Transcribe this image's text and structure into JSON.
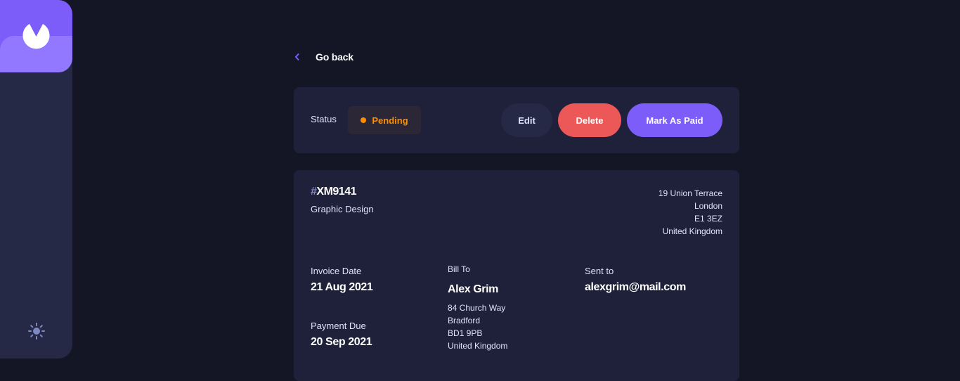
{
  "nav": {
    "back_label": "Go back"
  },
  "status_bar": {
    "status_label": "Status",
    "status_value": "Pending",
    "edit_label": "Edit",
    "delete_label": "Delete",
    "mark_paid_label": "Mark As Paid"
  },
  "invoice": {
    "hash": "#",
    "id": "XM9141",
    "description": "Graphic Design",
    "sender_address": [
      "19 Union Terrace",
      "London",
      "E1 3EZ",
      "United Kingdom"
    ],
    "invoice_date_label": "Invoice Date",
    "invoice_date": "21 Aug 2021",
    "payment_due_label": "Payment Due",
    "payment_due": "20 Sep 2021",
    "bill_to_label": "Bill To",
    "client_name": "Alex Grim",
    "client_address": [
      "84 Church Way",
      "Bradford",
      "BD1 9PB",
      "United Kingdom"
    ],
    "sent_to_label": "Sent to",
    "client_email": "alexgrim@mail.com"
  },
  "colors": {
    "background": "#141625",
    "sidebar": "#252945",
    "card": "#1e2139",
    "accent": "#7c5dfa",
    "accent_light": "#9277ff",
    "danger": "#ec5757",
    "pending": "#ff8f00"
  },
  "icons": {
    "logo": "logo-icon",
    "theme": "sun-icon",
    "back": "chevron-left-icon"
  }
}
